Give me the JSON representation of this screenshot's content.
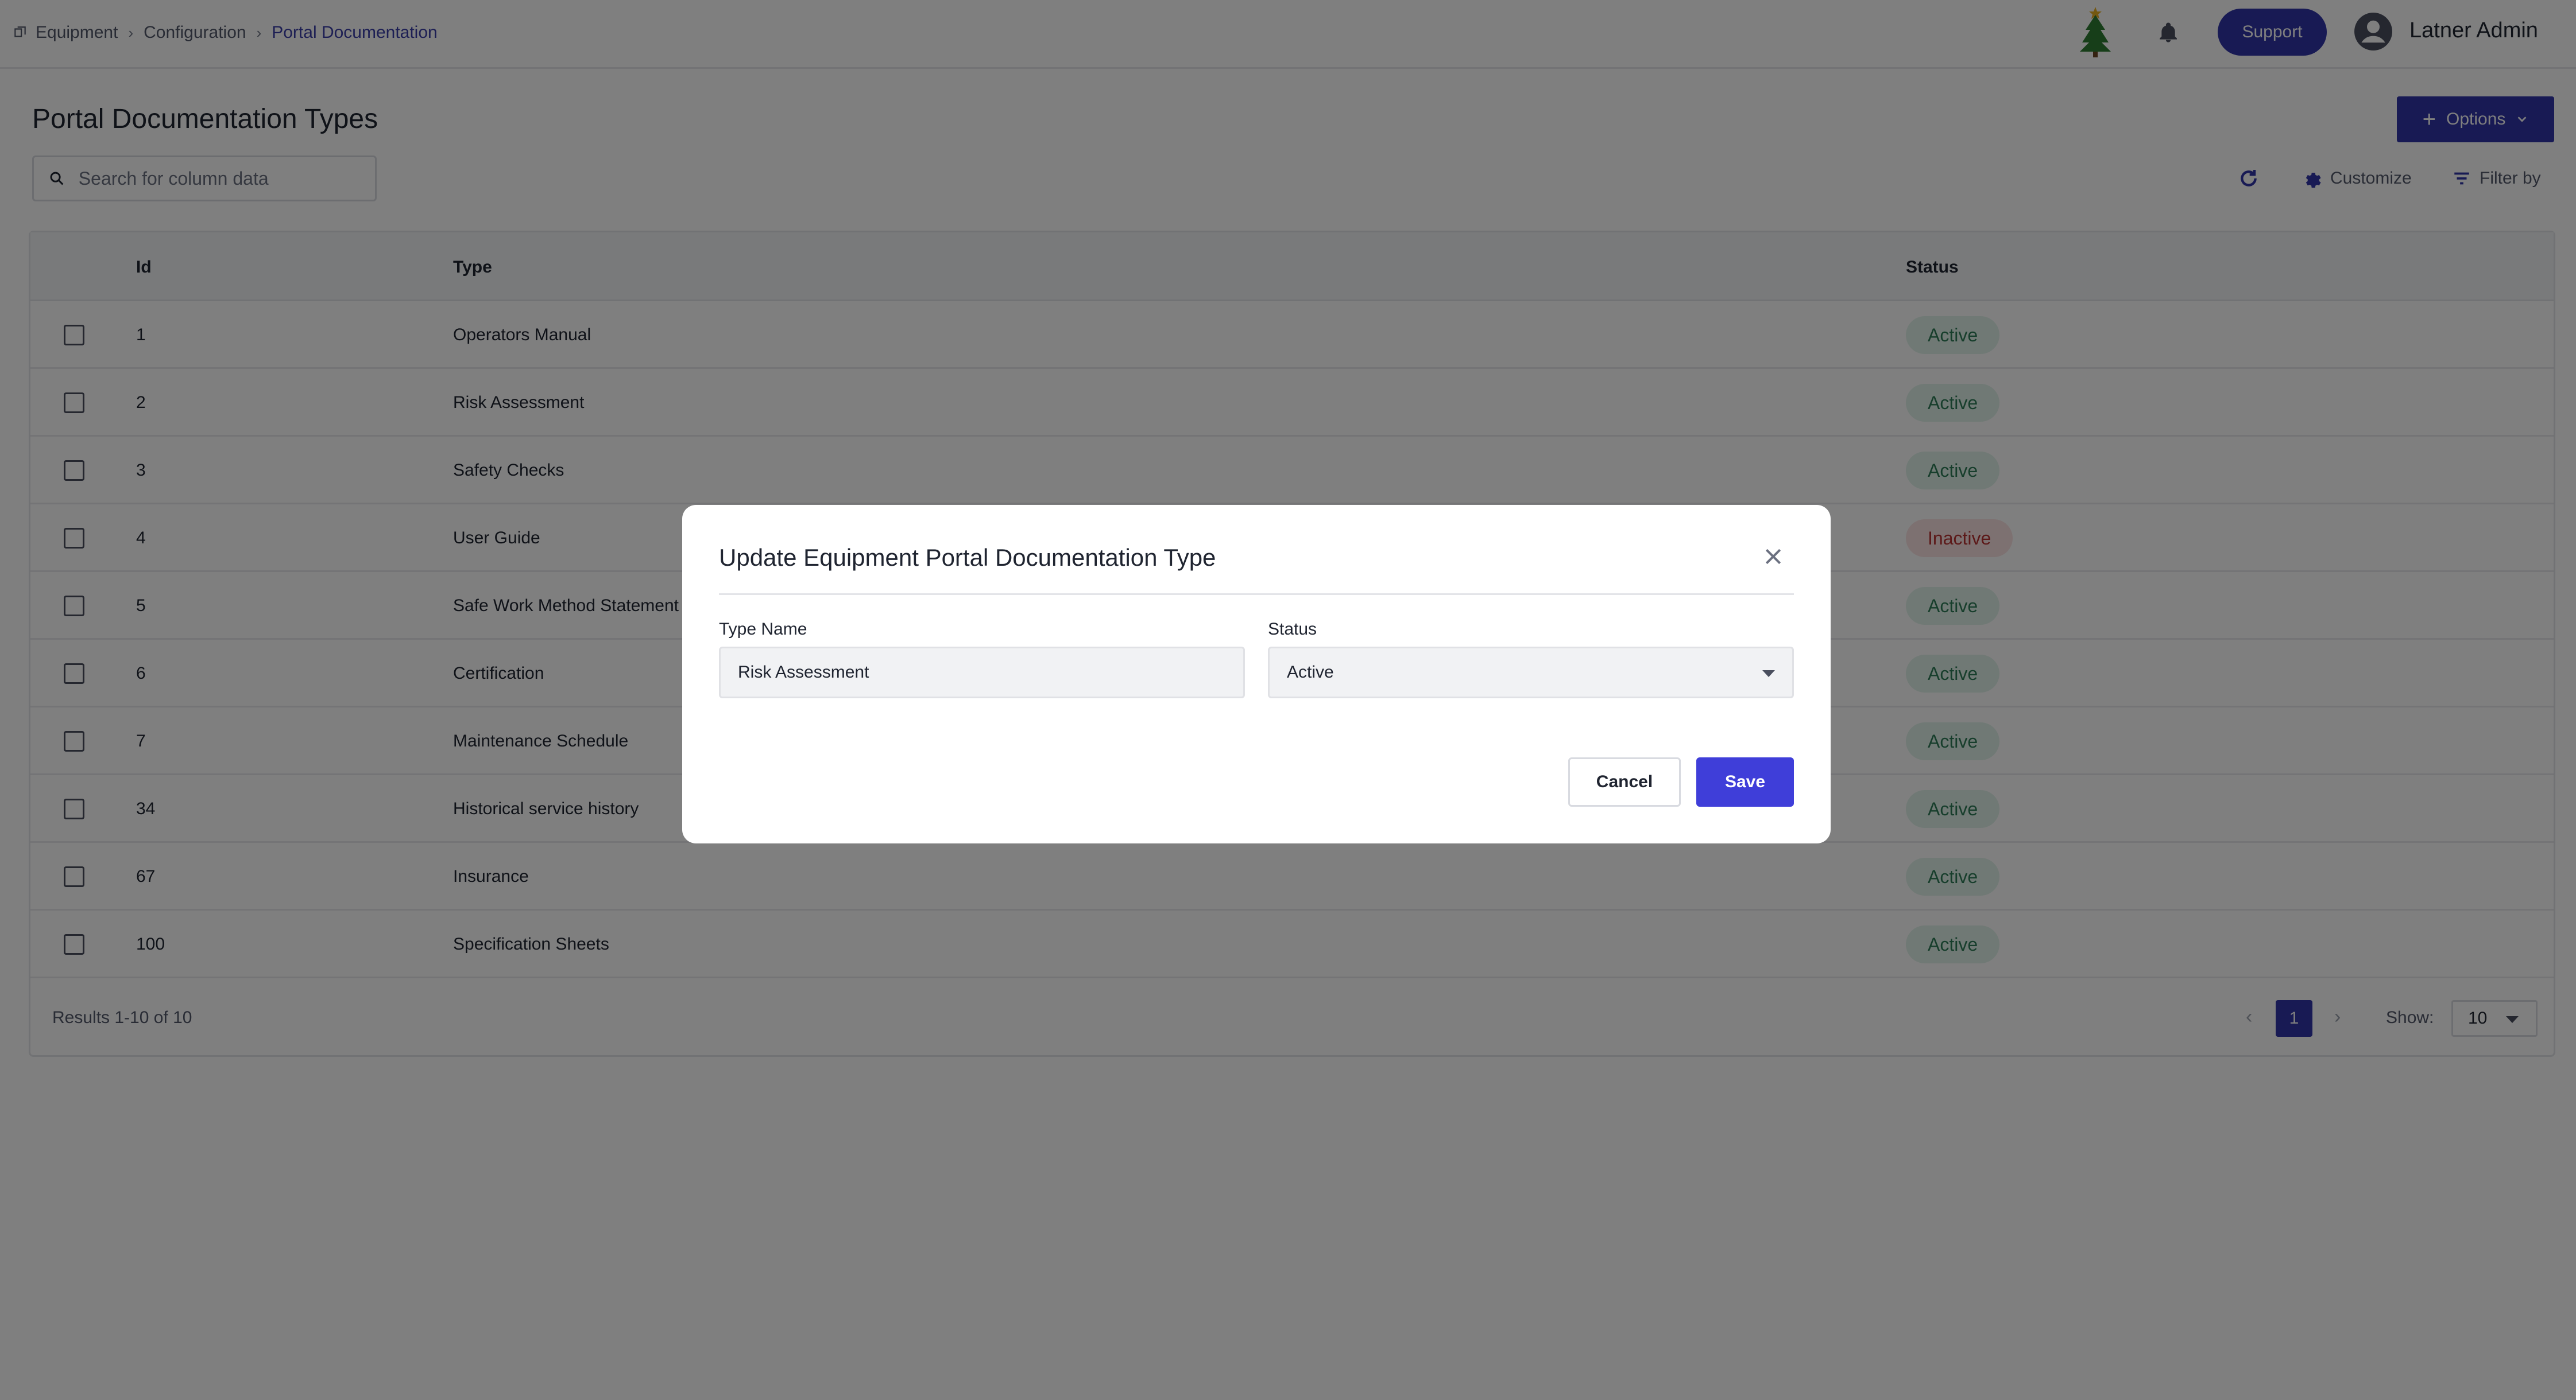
{
  "breadcrumb": {
    "items": [
      "Equipment",
      "Configuration",
      "Portal Documentation"
    ]
  },
  "header": {
    "support_label": "Support",
    "user_name": "Latner Admin"
  },
  "page": {
    "title": "Portal Documentation Types",
    "options_label": "Options"
  },
  "toolbar": {
    "search_placeholder": "Search for column data",
    "customize_label": "Customize",
    "filter_label": "Filter by"
  },
  "table": {
    "columns": [
      "Id",
      "Type",
      "Status"
    ],
    "rows": [
      {
        "id": "1",
        "type": "Operators Manual",
        "status": "Active"
      },
      {
        "id": "2",
        "type": "Risk Assessment",
        "status": "Active"
      },
      {
        "id": "3",
        "type": "Safety Checks",
        "status": "Active"
      },
      {
        "id": "4",
        "type": "User Guide",
        "status": "Inactive"
      },
      {
        "id": "5",
        "type": "Safe Work Method Statement (S",
        "status": "Active"
      },
      {
        "id": "6",
        "type": "Certification",
        "status": "Active"
      },
      {
        "id": "7",
        "type": "Maintenance Schedule",
        "status": "Active"
      },
      {
        "id": "34",
        "type": "Historical service history",
        "status": "Active"
      },
      {
        "id": "67",
        "type": "Insurance",
        "status": "Active"
      },
      {
        "id": "100",
        "type": "Specification Sheets",
        "status": "Active"
      }
    ],
    "results_text": "Results 1-10 of 10",
    "current_page": "1",
    "show_label": "Show:",
    "page_size": "10"
  },
  "modal": {
    "title": "Update Equipment Portal Documentation Type",
    "type_name_label": "Type Name",
    "type_name_value": "Risk Assessment",
    "status_label": "Status",
    "status_value": "Active",
    "cancel_label": "Cancel",
    "save_label": "Save"
  },
  "colors": {
    "primary": "#3135a8",
    "save": "#3f3ed9",
    "active_bg": "#e1f3ea",
    "active_text": "#2f7d58",
    "inactive_bg": "#fbe3e3",
    "inactive_text": "#b83333"
  },
  "icons": {
    "breadcrumb": "equipment-icon",
    "tree": "christmas-tree-icon",
    "bell": "bell-icon",
    "avatar": "user-avatar-icon",
    "search": "search-icon",
    "refresh": "refresh-icon",
    "customize": "gear-icon",
    "filter": "filter-icon",
    "close": "close-icon"
  }
}
